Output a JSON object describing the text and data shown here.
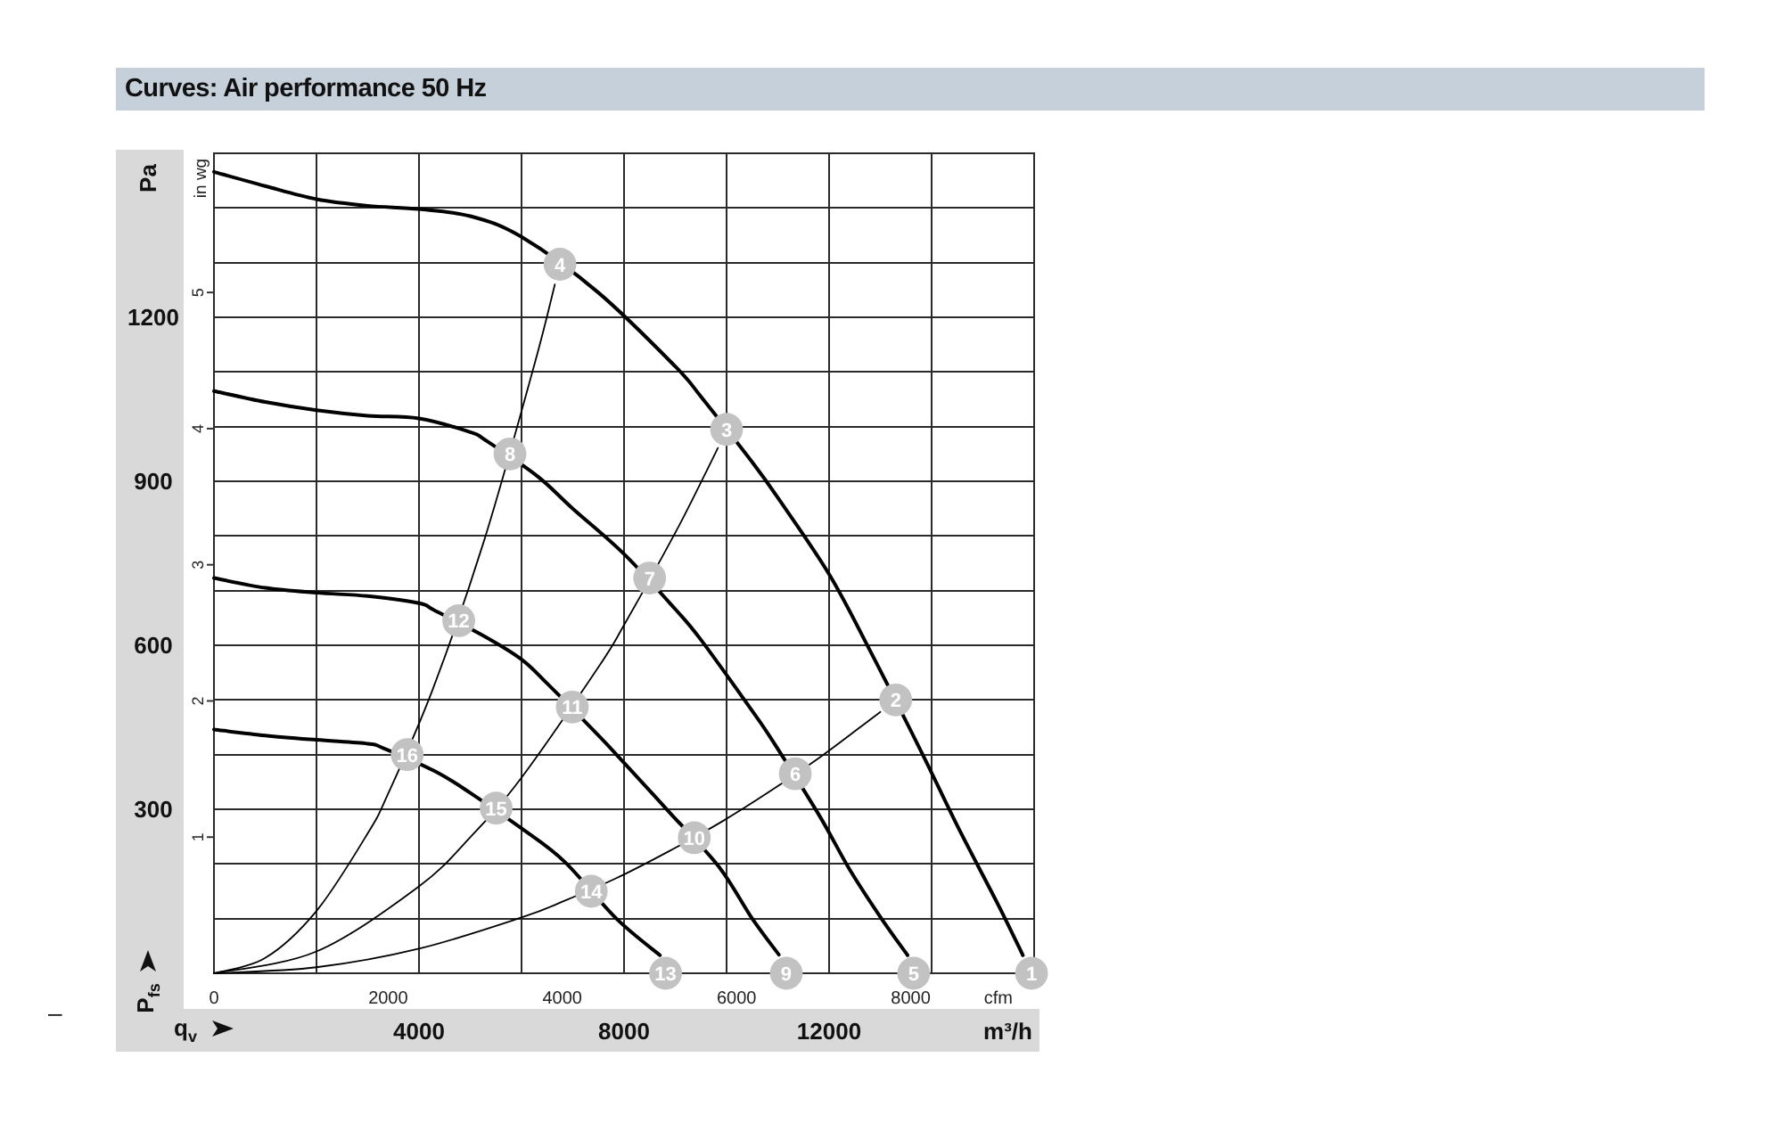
{
  "header": {
    "title": "Curves: Air performance 50 Hz"
  },
  "side_mark": "–",
  "chart": {
    "y_unit": "Pa",
    "x_unit": "m³/h",
    "secondary_y_axis": {
      "label": "in wg",
      "ticks": [
        "1",
        "2",
        "3",
        "4",
        "5"
      ]
    },
    "secondary_x_axis": {
      "label": "cfm",
      "ticks": [
        "0",
        "2000",
        "4000",
        "6000",
        "8000"
      ]
    },
    "chart_data": {
      "type": "line",
      "xlabel": "q$_{v}$",
      "ylabel": "P$_{fs}$",
      "xlim": [
        0,
        16000
      ],
      "ylim": [
        0,
        1500
      ],
      "xticks": [
        4000,
        8000,
        12000
      ],
      "yticks": [
        300,
        600,
        900,
        1200
      ],
      "grid": true,
      "series": [
        {
          "color": "#000000",
          "x": [
            0,
            1000,
            2000,
            3000,
            4000,
            5000,
            6000,
            7500,
            9000,
            9500,
            10500,
            11000,
            12000,
            12800,
            13800,
            14500,
            15300,
            15780
          ],
          "values": [
            1466,
            1440,
            1416,
            1404,
            1398,
            1385,
            1347,
            1245,
            1110,
            1055,
            935,
            870,
            730,
            590,
            405,
            270,
            125,
            33
          ]
        },
        {
          "color": "#000000",
          "x": [
            0,
            1000,
            2000,
            3000,
            4000,
            5000,
            5300,
            6300,
            7000,
            8000,
            9000,
            9500,
            10500,
            10900,
            11800,
            12400,
            13000,
            13530
          ],
          "values": [
            1065,
            1045,
            1030,
            1020,
            1015,
            990,
            975,
            910,
            850,
            767,
            666,
            610,
            480,
            425,
            290,
            190,
            103,
            33
          ]
        },
        {
          "color": "#000000",
          "x": [
            0,
            1000,
            2000,
            3000,
            4000,
            4300,
            5300,
            6000,
            6500,
            7500,
            8000,
            8900,
            9850,
            10500,
            11020
          ],
          "values": [
            723,
            705,
            696,
            690,
            677,
            664,
            615,
            574,
            530,
            435,
            385,
            293,
            195,
            100,
            34
          ]
        },
        {
          "color": "#000000",
          "x": [
            0,
            1000,
            2000,
            3000,
            3300,
            4300,
            5000,
            6000,
            6840,
            7850,
            8700
          ],
          "values": [
            446,
            435,
            427,
            420,
            412,
            370,
            330,
            265,
            204,
            100,
            33
          ]
        },
        {
          "color": "#000000",
          "x": [
            0,
            1000,
            2000,
            3000,
            3400,
            4270,
            5275,
            6250,
            6650
          ],
          "values": [
            0,
            28,
            114,
            256,
            329,
            520,
            793,
            1113,
            1260
          ]
        },
        {
          "color": "#000000",
          "x": [
            0,
            2000,
            4000,
            5000,
            6000,
            7500,
            8000,
            9000,
            9600,
            9830
          ],
          "values": [
            0,
            40,
            159,
            249,
            358,
            560,
            637,
            806,
            917,
            961
          ]
        },
        {
          "color": "#000000",
          "x": [
            0,
            2000,
            4000,
            6000,
            6850,
            7850,
            8850,
            9900,
            10800,
            11850,
            12800,
            13000
          ],
          "values": [
            0,
            11,
            45,
            102,
            133,
            174,
            222,
            277,
            330,
            397,
            464,
            478
          ]
        }
      ],
      "annotations": [
        {
          "text": "1",
          "x": 15950,
          "y": 0
        },
        {
          "text": "2",
          "x": 13300,
          "y": 500
        },
        {
          "text": "3",
          "x": 10000,
          "y": 995
        },
        {
          "text": "4",
          "x": 6750,
          "y": 1297
        },
        {
          "text": "5",
          "x": 13650,
          "y": 0
        },
        {
          "text": "6",
          "x": 11340,
          "y": 365
        },
        {
          "text": "7",
          "x": 8500,
          "y": 723
        },
        {
          "text": "8",
          "x": 5775,
          "y": 950
        },
        {
          "text": "9",
          "x": 11165,
          "y": 0
        },
        {
          "text": "10",
          "x": 9370,
          "y": 248
        },
        {
          "text": "11",
          "x": 6990,
          "y": 487
        },
        {
          "text": "12",
          "x": 4775,
          "y": 645
        },
        {
          "text": "13",
          "x": 8810,
          "y": 0
        },
        {
          "text": "14",
          "x": 7360,
          "y": 150
        },
        {
          "text": "15",
          "x": 5505,
          "y": 302
        },
        {
          "text": "16",
          "x": 3770,
          "y": 400
        }
      ]
    }
  }
}
